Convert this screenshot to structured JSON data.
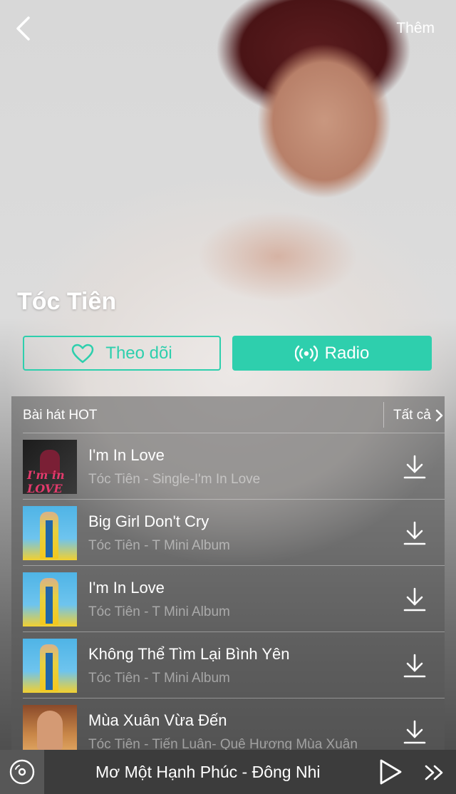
{
  "topbar": {
    "more_label": "Thêm"
  },
  "artist": {
    "name": "Tóc Tiên"
  },
  "actions": {
    "follow_label": "Theo dõi",
    "radio_label": "Radio"
  },
  "hot_songs": {
    "title": "Bài hát HOT",
    "see_all_label": "Tất cả",
    "items": [
      {
        "title": "I'm In Love",
        "subtitle": "Tóc Tiên - Single-I'm In Love",
        "thumb": "dark"
      },
      {
        "title": "Big Girl Don't Cry",
        "subtitle": "Tóc Tiên - T Mini Album",
        "thumb": "blue"
      },
      {
        "title": "I'm In Love",
        "subtitle": "Tóc Tiên - T Mini Album",
        "thumb": "blue"
      },
      {
        "title": "Không Thể Tìm Lại Bình Yên",
        "subtitle": "Tóc Tiên - T Mini Album",
        "thumb": "blue"
      },
      {
        "title": "Mùa Xuân Vừa Đến",
        "subtitle": "Tóc Tiên - Tiến Luân- Quê Hương Mùa Xuân",
        "thumb": "orange"
      }
    ]
  },
  "player": {
    "now_playing": "Mơ Một Hạnh Phúc - Đông Nhi"
  },
  "colors": {
    "accent": "#2ecfad",
    "player_bg": "#3c3c3c"
  },
  "icons": {
    "back": "chevron-left-icon",
    "follow": "heart-icon",
    "radio": "radio-broadcast-icon",
    "see_all": "chevron-right-icon",
    "download": "download-icon",
    "disc": "disc-icon",
    "play": "play-icon",
    "next": "fast-forward-icon"
  }
}
